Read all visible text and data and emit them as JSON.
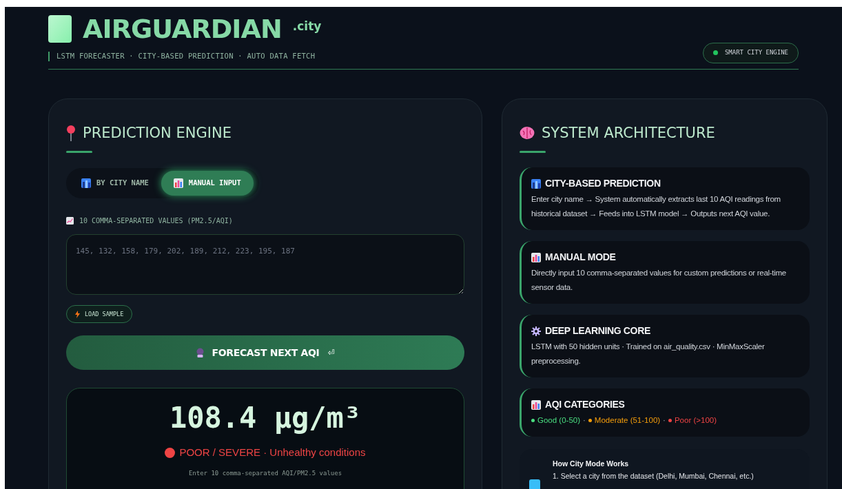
{
  "header": {
    "title": "AIRGUARDIAN",
    "suffix": ".city",
    "tagline": "LSTM FORECASTER · CITY-BASED PREDICTION · AUTO DATA FETCH",
    "badge": {
      "label": "SMART CITY ENGINE",
      "color": "#22c55e"
    }
  },
  "prediction": {
    "title": "PREDICTION ENGINE",
    "tabs": [
      {
        "label": "BY CITY NAME",
        "kind": "city",
        "selected": false
      },
      {
        "label": "MANUAL INPUT",
        "kind": "chart",
        "selected": true
      }
    ],
    "field_label": "10 COMMA-SEPARATED VALUES (PM2.5/AQI)",
    "input": {
      "placeholder": "145, 132, 158, 179, 202, 189, 212, 223, 195, 187"
    },
    "sample_button": "LOAD SAMPLE",
    "forecast_button": {
      "label": "FORECAST NEXT AQI",
      "symbol": "⏎"
    },
    "result": {
      "value": "108.4 µg/m³",
      "status": "POOR / SEVERE · Unhealthy conditions",
      "kind": "poor",
      "hint": "Enter 10 comma-separated AQI/PM2.5 values"
    }
  },
  "architecture": {
    "title": "SYSTEM ARCHITECTURE",
    "cards": [
      {
        "kind": "city",
        "title": "CITY-BASED PREDICTION",
        "text": "Enter city name → System automatically extracts last 10 AQI readings from historical dataset → Feeds into LSTM model → Outputs next AQI value."
      },
      {
        "kind": "chart",
        "title": "MANUAL MODE",
        "text": "Directly input 10 comma-separated values for custom predictions or real-time sensor data."
      },
      {
        "kind": "gear",
        "title": "DEEP LEARNING CORE",
        "text": "LSTM with 50 hidden units · Trained on air_quality.csv · MinMaxScaler preprocessing."
      },
      {
        "kind": "chart",
        "title": "AQI CATEGORIES",
        "separator": "·",
        "categories": [
          {
            "label": "Good (0-50)",
            "color": "#4ade80"
          },
          {
            "label": "Moderate (51-100)",
            "color": "#f59e0b"
          },
          {
            "label": "Poor (>100)",
            "color": "#ef4444"
          }
        ]
      }
    ],
    "how": {
      "title": "How City Mode Works",
      "steps": [
        "1. Select a city from the dataset (Delhi, Mumbai, Chennai, etc.)"
      ]
    }
  }
}
